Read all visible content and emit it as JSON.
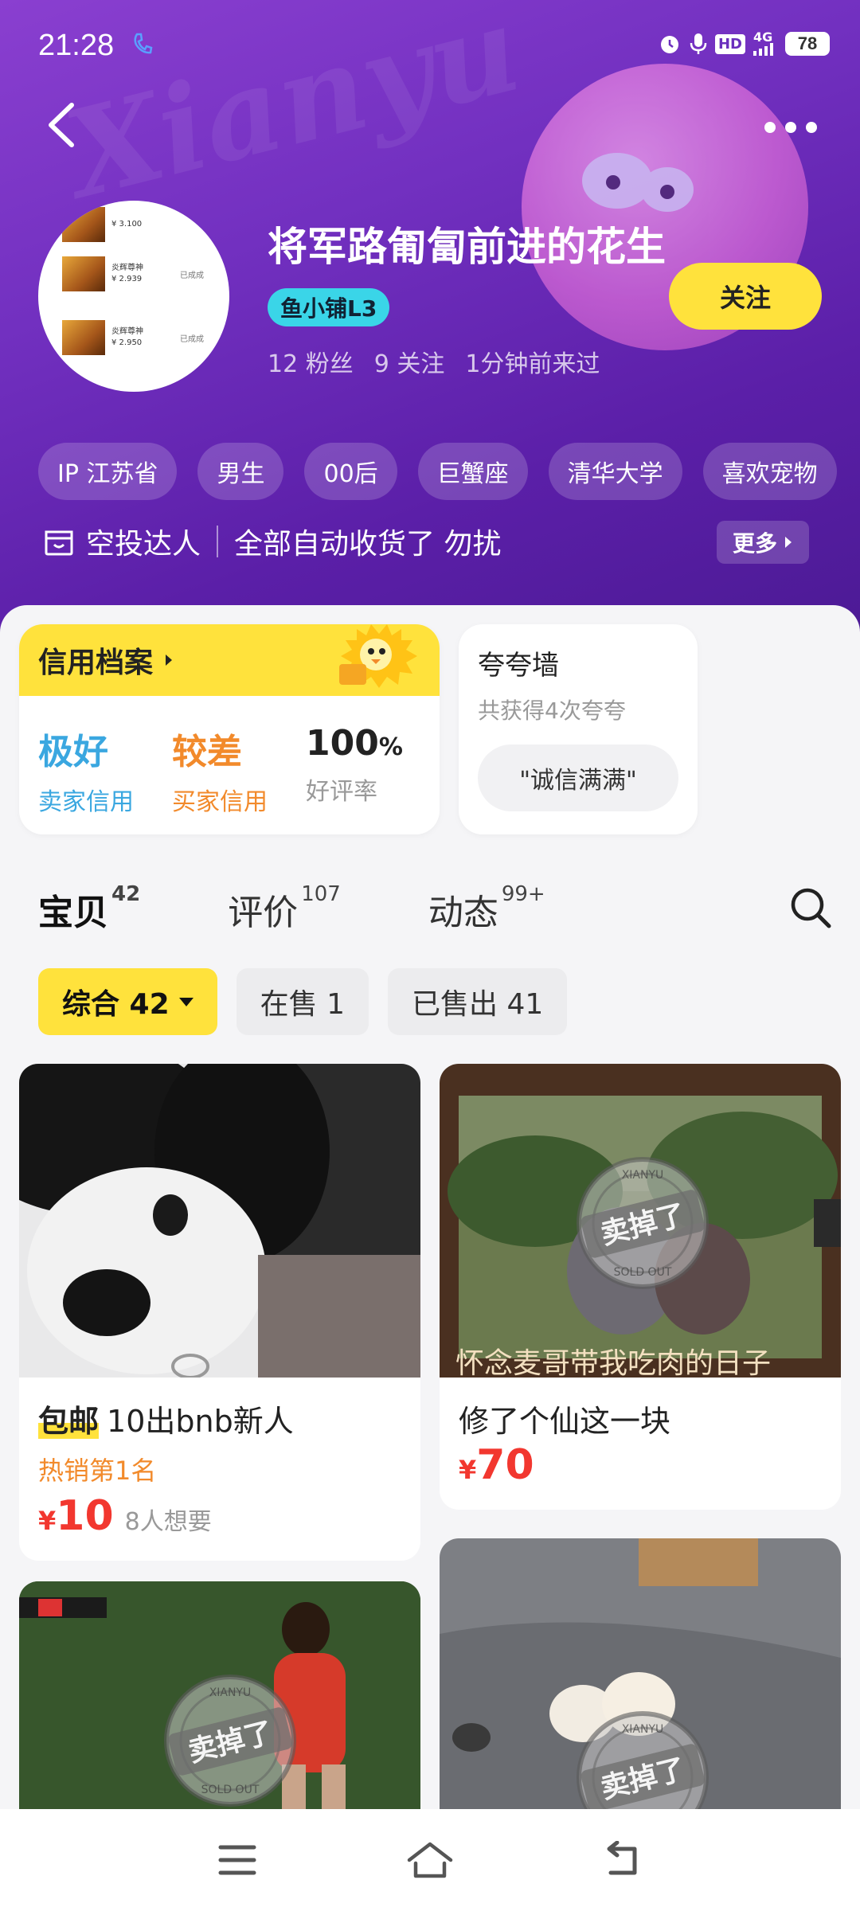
{
  "status_bar": {
    "time": "21:28",
    "hd": "HD",
    "network": "4G",
    "battery": "78"
  },
  "profile": {
    "watermark": "Xianyu",
    "nickname": "将军路匍匐前进的花生",
    "shop_badge": "鱼小铺L3",
    "stats": [
      "12 粉丝",
      "9 关注",
      "1分钟前来过"
    ],
    "follow_label": "关注",
    "avatar_rows": [
      {
        "price": "¥ 3.100",
        "name": "",
        "status": ""
      },
      {
        "price": "¥ 2.939",
        "name": "炎辉尊神",
        "status": "已成成"
      },
      {
        "price": "¥ 2.950",
        "name": "炎辉尊神",
        "status": "已成成"
      }
    ]
  },
  "tags": [
    "IP 江苏省",
    "男生",
    "00后",
    "巨蟹座",
    "清华大学",
    "喜欢宠物"
  ],
  "bio": {
    "role": "空投达人",
    "text": "全部自动收货了 勿扰",
    "more_label": "更多"
  },
  "credit": {
    "title": "信用档案",
    "items": [
      {
        "value": "极好",
        "label": "卖家信用"
      },
      {
        "value": "较差",
        "label": "买家信用"
      },
      {
        "value": "100",
        "unit": "%",
        "label": "好评率"
      }
    ]
  },
  "praise": {
    "title": "夸夸墙",
    "subtitle": "共获得4次夸夸",
    "chip": "\"诚信满满\""
  },
  "tabs": [
    {
      "label": "宝贝",
      "count": "42"
    },
    {
      "label": "评价",
      "count": "107"
    },
    {
      "label": "动态",
      "count": "99+"
    }
  ],
  "filters": [
    {
      "label": "综合 42"
    },
    {
      "label": "在售 1"
    },
    {
      "label": "已售出 41"
    }
  ],
  "products": [
    {
      "badge": "包邮",
      "title": "10出bnb新人",
      "hot": "热销第1名",
      "currency": "¥",
      "price": "10",
      "wants": "8人想要"
    },
    {
      "title": "修了个仙这一块",
      "currency": "¥",
      "price": "70",
      "image_caption": "怀念麦哥带我吃肉的日子"
    }
  ],
  "sold_stamp": {
    "text": "卖掉了",
    "brand": "XIANYU",
    "sub": "SOLD OUT"
  },
  "colors": {
    "accent": "#ffe23c",
    "header": "#6a2fbd",
    "price": "#f2372f",
    "seller_credit": "#3aa7e0",
    "buyer_credit": "#f28a2b"
  }
}
